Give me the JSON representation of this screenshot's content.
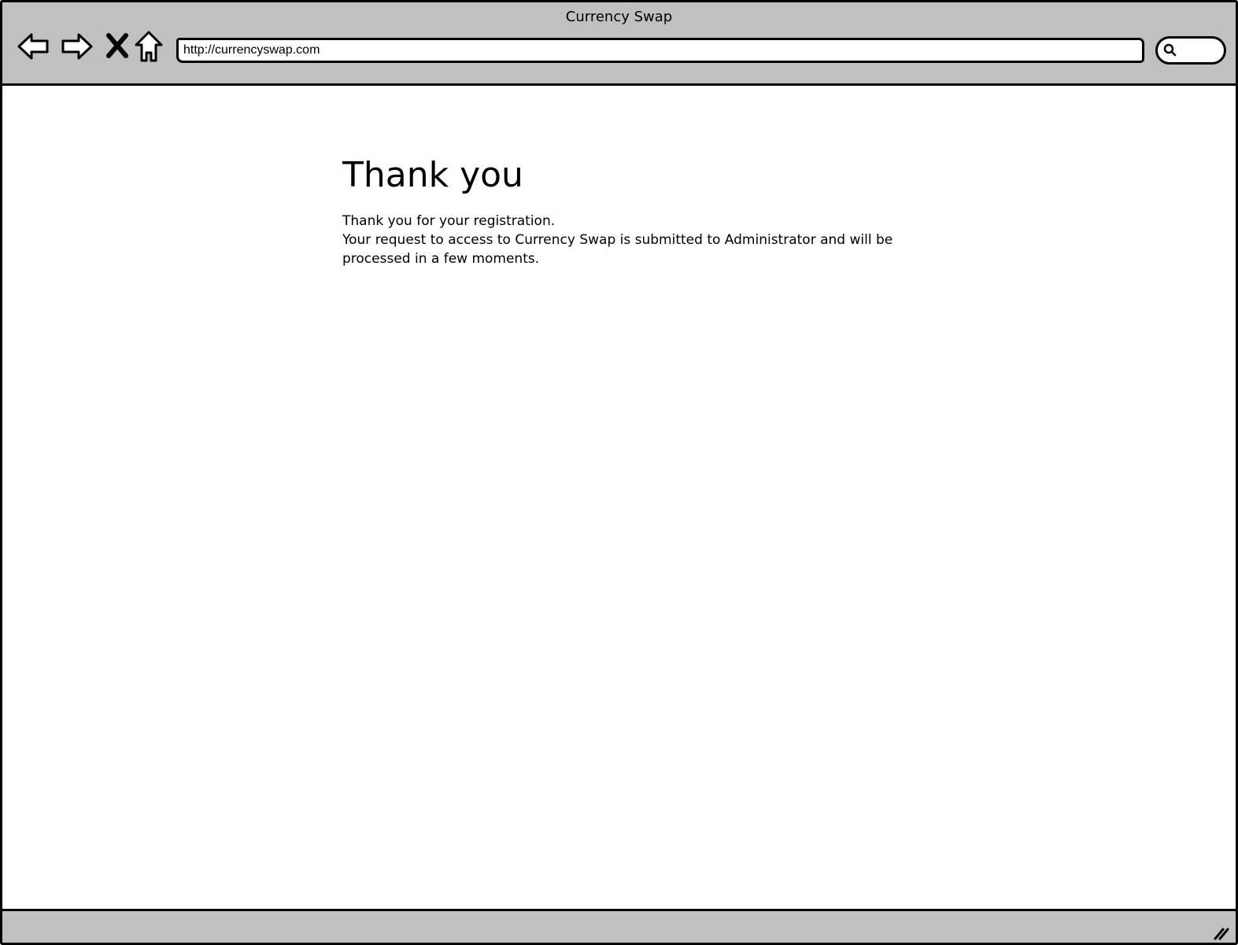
{
  "window": {
    "title": "Currency Swap"
  },
  "toolbar": {
    "back_icon": "arrow-left-icon",
    "forward_icon": "arrow-right-icon",
    "stop_icon": "close-icon",
    "home_icon": "home-icon",
    "search_icon": "search-icon"
  },
  "address_bar": {
    "url": "http://currencyswap.com"
  },
  "page": {
    "title": "Thank you",
    "message_lines": [
      "Thank you for your registration.",
      "Your request to access to Currency Swap is submitted to Administrator and will be",
      "processed in a few moments."
    ]
  },
  "colors": {
    "chrome": "#c0c0c0",
    "background": "#ffffff",
    "ink": "#000000"
  }
}
